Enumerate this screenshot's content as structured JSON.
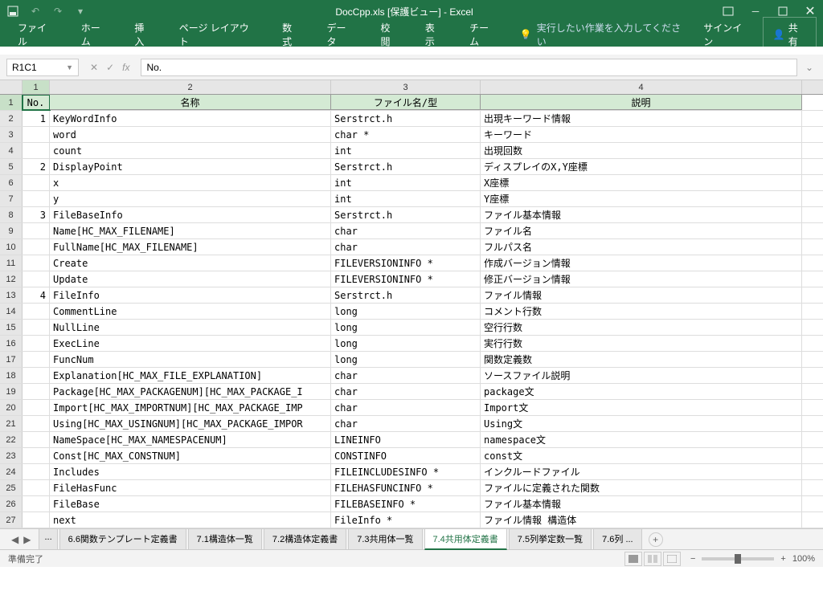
{
  "title": "DocCpp.xls  [保護ビュー] - Excel",
  "ribbon": {
    "tabs": [
      "ファイル",
      "ホーム",
      "挿入",
      "ページ レイアウト",
      "数式",
      "データ",
      "校閲",
      "表示",
      "チーム"
    ],
    "tell": "実行したい作業を入力してください",
    "signin": "サインイン",
    "share": "共有"
  },
  "namebox": "R1C1",
  "formula": "No.",
  "columns": [
    "1",
    "2",
    "3",
    "4"
  ],
  "headers": [
    "No.",
    "名称",
    "ファイル名/型",
    "説明"
  ],
  "rows": [
    {
      "r": "1",
      "no": "",
      "a": "No.",
      "b": "名称",
      "c": "ファイル名/型",
      "d": "説明",
      "hdr": true
    },
    {
      "r": "2",
      "no": "1",
      "a": "",
      "b": "KeyWordInfo",
      "c": "Serstrct.h",
      "d": "出現キーワード情報"
    },
    {
      "r": "3",
      "no": "",
      "a": "",
      "b": "word",
      "c": "char *",
      "d": "キーワード"
    },
    {
      "r": "4",
      "no": "",
      "a": "",
      "b": "count",
      "c": "int",
      "d": "出現回数"
    },
    {
      "r": "5",
      "no": "2",
      "a": "",
      "b": "DisplayPoint",
      "c": "Serstrct.h",
      "d": "ディスプレイのX,Y座標"
    },
    {
      "r": "6",
      "no": "",
      "a": "",
      "b": "x",
      "c": "int",
      "d": "X座標"
    },
    {
      "r": "7",
      "no": "",
      "a": "",
      "b": "y",
      "c": "int",
      "d": "Y座標"
    },
    {
      "r": "8",
      "no": "3",
      "a": "",
      "b": "FileBaseInfo",
      "c": "Serstrct.h",
      "d": "ファイル基本情報"
    },
    {
      "r": "9",
      "no": "",
      "a": "",
      "b": "Name[HC_MAX_FILENAME]",
      "c": "char",
      "d": "ファイル名"
    },
    {
      "r": "10",
      "no": "",
      "a": "",
      "b": "FullName[HC_MAX_FILENAME]",
      "c": "char",
      "d": "フルパス名"
    },
    {
      "r": "11",
      "no": "",
      "a": "",
      "b": "Create",
      "c": "FILEVERSIONINFO *",
      "d": "作成バージョン情報"
    },
    {
      "r": "12",
      "no": "",
      "a": "",
      "b": "Update",
      "c": "FILEVERSIONINFO *",
      "d": "修正バージョン情報"
    },
    {
      "r": "13",
      "no": "4",
      "a": "",
      "b": "FileInfo",
      "c": "Serstrct.h",
      "d": "ファイル情報"
    },
    {
      "r": "14",
      "no": "",
      "a": "",
      "b": "CommentLine",
      "c": "long",
      "d": "コメント行数"
    },
    {
      "r": "15",
      "no": "",
      "a": "",
      "b": "NullLine",
      "c": "long",
      "d": "空行行数"
    },
    {
      "r": "16",
      "no": "",
      "a": "",
      "b": "ExecLine",
      "c": "long",
      "d": "実行行数"
    },
    {
      "r": "17",
      "no": "",
      "a": "",
      "b": "FuncNum",
      "c": "long",
      "d": "関数定義数"
    },
    {
      "r": "18",
      "no": "",
      "a": "",
      "b": "Explanation[HC_MAX_FILE_EXPLANATION]",
      "c": "char",
      "d": "ソースファイル説明"
    },
    {
      "r": "19",
      "no": "",
      "a": "",
      "b": "Package[HC_MAX_PACKAGENUM][HC_MAX_PACKAGE_I",
      "c": "char",
      "d": "package文"
    },
    {
      "r": "20",
      "no": "",
      "a": "",
      "b": "Import[HC_MAX_IMPORTNUM][HC_MAX_PACKAGE_IMP",
      "c": "char",
      "d": "Import文"
    },
    {
      "r": "21",
      "no": "",
      "a": "",
      "b": "Using[HC_MAX_USINGNUM][HC_MAX_PACKAGE_IMPOR",
      "c": "char",
      "d": "Using文"
    },
    {
      "r": "22",
      "no": "",
      "a": "",
      "b": "NameSpace[HC_MAX_NAMESPACENUM]",
      "c": "LINEINFO",
      "d": "namespace文"
    },
    {
      "r": "23",
      "no": "",
      "a": "",
      "b": "Const[HC_MAX_CONSTNUM]",
      "c": "CONSTINFO",
      "d": "const文"
    },
    {
      "r": "24",
      "no": "",
      "a": "",
      "b": "Includes",
      "c": "FILEINCLUDESINFO *",
      "d": "インクルードファイル"
    },
    {
      "r": "25",
      "no": "",
      "a": "",
      "b": "FileHasFunc",
      "c": "FILEHASFUNCINFO *",
      "d": "ファイルに定義された関数"
    },
    {
      "r": "26",
      "no": "",
      "a": "",
      "b": "FileBase",
      "c": "FILEBASEINFO *",
      "d": "ファイル基本情報"
    },
    {
      "r": "27",
      "no": "",
      "a": "",
      "b": "next",
      "c": "FileInfo *",
      "d": "ファイル情報 構造体"
    }
  ],
  "sheets": {
    "tabs": [
      "...",
      "6.6関数テンプレート定義書",
      "7.1構造体一覧",
      "7.2構造体定義書",
      "7.3共用体一覧",
      "7.4共用体定義書",
      "7.5列挙定数一覧",
      "7.6列 ..."
    ],
    "active": 5
  },
  "status": {
    "left": "準備完了",
    "zoom": "100%"
  }
}
